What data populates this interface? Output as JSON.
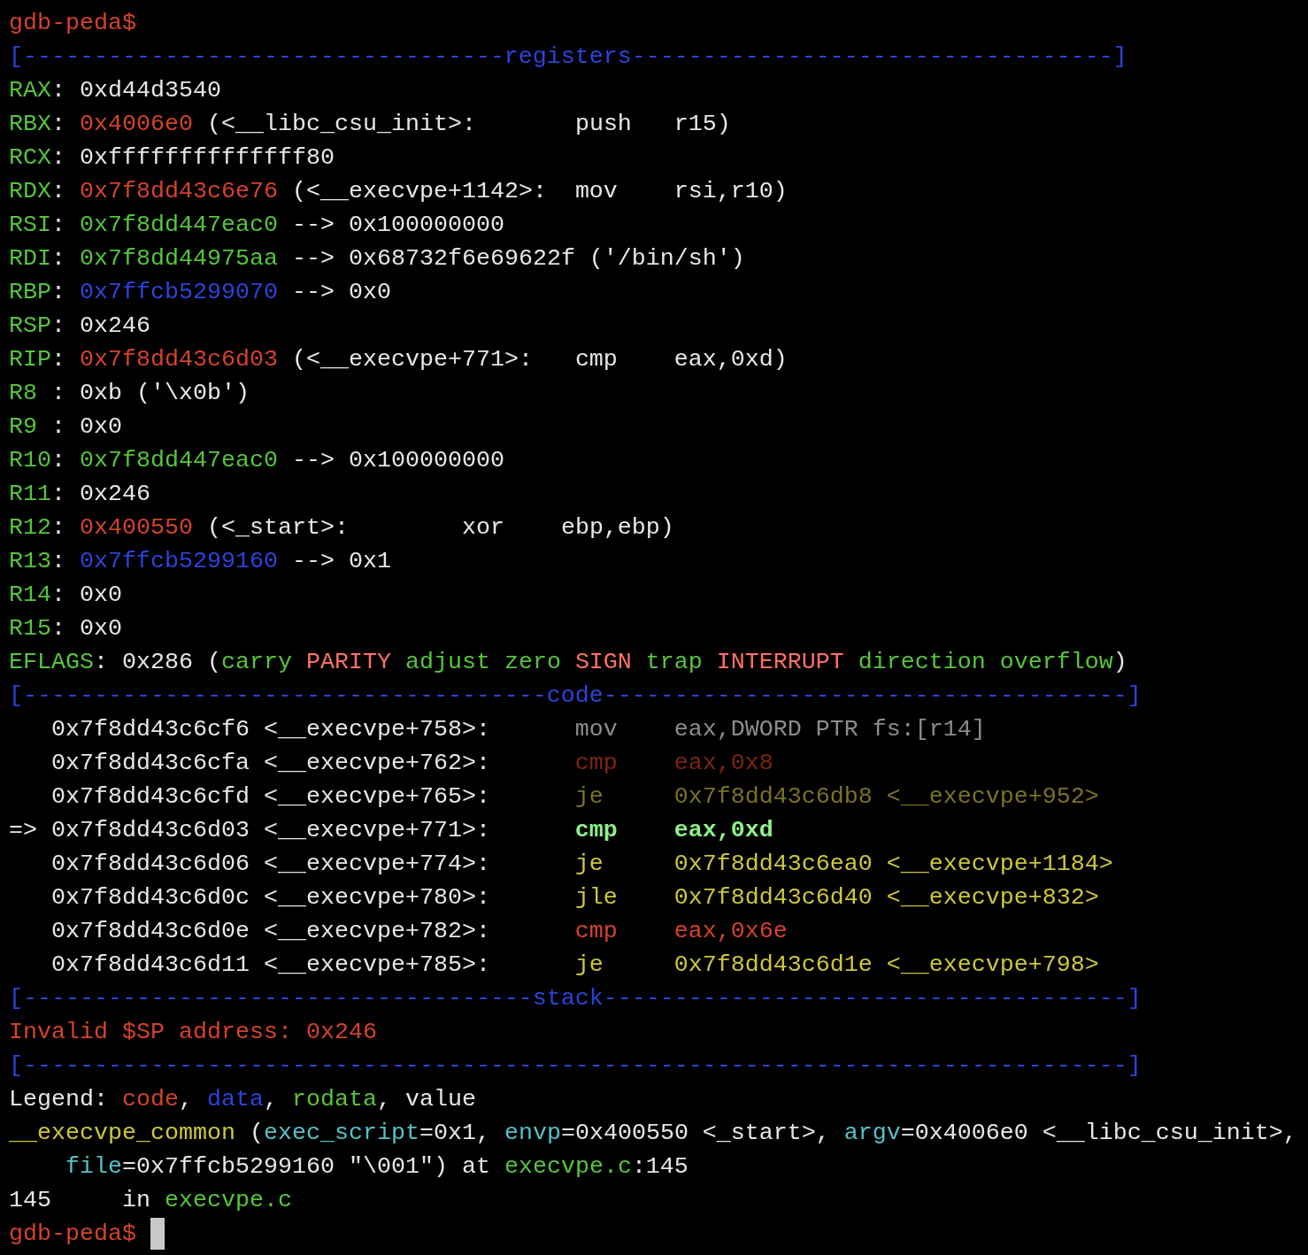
{
  "terminal": {
    "lines": [
      {
        "kind": "prompt",
        "cursor": false,
        "segments": [
          {
            "text": "gdb-peda$",
            "kind": "prompt"
          }
        ]
      },
      {
        "kind": "separator",
        "segments": [
          {
            "text": "[----------------------------------registers----------------------------------]",
            "kind": "separator"
          }
        ]
      },
      {
        "kind": "register",
        "segments": [
          {
            "text": "RAX",
            "kind": "register"
          },
          {
            "text": ": 0xd44d3540",
            "kind": "plain"
          }
        ]
      },
      {
        "kind": "register",
        "segments": [
          {
            "text": "RBX",
            "kind": "register"
          },
          {
            "text": ": ",
            "kind": "plain"
          },
          {
            "text": "0x4006e0",
            "kind": "code"
          },
          {
            "text": " (<__libc_csu_init>:       push   r15)",
            "kind": "plain"
          }
        ]
      },
      {
        "kind": "register",
        "segments": [
          {
            "text": "RCX",
            "kind": "register"
          },
          {
            "text": ": 0xffffffffffffff80",
            "kind": "plain"
          }
        ]
      },
      {
        "kind": "register",
        "segments": [
          {
            "text": "RDX",
            "kind": "register"
          },
          {
            "text": ": ",
            "kind": "plain"
          },
          {
            "text": "0x7f8dd43c6e76",
            "kind": "code"
          },
          {
            "text": " (<__execvpe+1142>:  mov    rsi,r10)",
            "kind": "plain"
          }
        ]
      },
      {
        "kind": "register",
        "segments": [
          {
            "text": "RSI",
            "kind": "register"
          },
          {
            "text": ": ",
            "kind": "plain"
          },
          {
            "text": "0x7f8dd447eac0",
            "kind": "rodata"
          },
          {
            "text": " --> 0x100000000",
            "kind": "plain"
          }
        ]
      },
      {
        "kind": "register",
        "segments": [
          {
            "text": "RDI",
            "kind": "register"
          },
          {
            "text": ": ",
            "kind": "plain"
          },
          {
            "text": "0x7f8dd44975aa",
            "kind": "rodata"
          },
          {
            "text": " --> 0x68732f6e69622f ('/bin/sh')",
            "kind": "plain"
          }
        ]
      },
      {
        "kind": "register",
        "segments": [
          {
            "text": "RBP",
            "kind": "register"
          },
          {
            "text": ": ",
            "kind": "plain"
          },
          {
            "text": "0x7ffcb5299070",
            "kind": "data"
          },
          {
            "text": " --> 0x0",
            "kind": "plain"
          }
        ]
      },
      {
        "kind": "register",
        "segments": [
          {
            "text": "RSP",
            "kind": "register"
          },
          {
            "text": ": 0x246",
            "kind": "plain"
          }
        ]
      },
      {
        "kind": "register",
        "segments": [
          {
            "text": "RIP",
            "kind": "register"
          },
          {
            "text": ": ",
            "kind": "plain"
          },
          {
            "text": "0x7f8dd43c6d03",
            "kind": "code"
          },
          {
            "text": " (<__execvpe+771>:   cmp    eax,0xd)",
            "kind": "plain"
          }
        ]
      },
      {
        "kind": "register",
        "segments": [
          {
            "text": "R8",
            "kind": "register"
          },
          {
            "text": " : 0xb ('\\x0b')",
            "kind": "plain"
          }
        ]
      },
      {
        "kind": "register",
        "segments": [
          {
            "text": "R9",
            "kind": "register"
          },
          {
            "text": " : 0x0",
            "kind": "plain"
          }
        ]
      },
      {
        "kind": "register",
        "segments": [
          {
            "text": "R10",
            "kind": "register"
          },
          {
            "text": ": ",
            "kind": "plain"
          },
          {
            "text": "0x7f8dd447eac0",
            "kind": "rodata"
          },
          {
            "text": " --> 0x100000000",
            "kind": "plain"
          }
        ]
      },
      {
        "kind": "register",
        "segments": [
          {
            "text": "R11",
            "kind": "register"
          },
          {
            "text": ": 0x246",
            "kind": "plain"
          }
        ]
      },
      {
        "kind": "register",
        "segments": [
          {
            "text": "R12",
            "kind": "register"
          },
          {
            "text": ": ",
            "kind": "plain"
          },
          {
            "text": "0x400550",
            "kind": "code"
          },
          {
            "text": " (<_start>:        xor    ebp,ebp)",
            "kind": "plain"
          }
        ]
      },
      {
        "kind": "register",
        "segments": [
          {
            "text": "R13",
            "kind": "register"
          },
          {
            "text": ": ",
            "kind": "plain"
          },
          {
            "text": "0x7ffcb5299160",
            "kind": "data"
          },
          {
            "text": " --> 0x1",
            "kind": "plain"
          }
        ]
      },
      {
        "kind": "register",
        "segments": [
          {
            "text": "R14",
            "kind": "register"
          },
          {
            "text": ": 0x0",
            "kind": "plain"
          }
        ]
      },
      {
        "kind": "register",
        "segments": [
          {
            "text": "R15",
            "kind": "register"
          },
          {
            "text": ": 0x0",
            "kind": "plain"
          }
        ]
      },
      {
        "kind": "register",
        "segments": [
          {
            "text": "EFLAGS",
            "kind": "register"
          },
          {
            "text": ": 0x286 (",
            "kind": "plain"
          },
          {
            "text": "carry ",
            "kind": "flag_clear"
          },
          {
            "text": "PARITY",
            "kind": "flag_set"
          },
          {
            "text": " adjust zero ",
            "kind": "flag_clear"
          },
          {
            "text": "SIGN",
            "kind": "flag_set"
          },
          {
            "text": " trap ",
            "kind": "flag_clear"
          },
          {
            "text": "INTERRUPT",
            "kind": "flag_set"
          },
          {
            "text": " direction overflow",
            "kind": "flag_clear"
          },
          {
            "text": ")",
            "kind": "plain"
          }
        ]
      },
      {
        "kind": "separator",
        "segments": [
          {
            "text": "[-------------------------------------code-------------------------------------]",
            "kind": "separator"
          }
        ]
      },
      {
        "kind": "code",
        "segments": [
          {
            "text": "   0x7f8dd43c6cf6 <__execvpe+758>:      ",
            "kind": "plain"
          },
          {
            "text": "mov    eax,DWORD PTR fs:[r14]",
            "kind": "dim_plain"
          }
        ]
      },
      {
        "kind": "code",
        "segments": [
          {
            "text": "   0x7f8dd43c6cfa <__execvpe+762>:      ",
            "kind": "plain"
          },
          {
            "text": "cmp    eax,0x8",
            "kind": "dim_code"
          }
        ]
      },
      {
        "kind": "code",
        "segments": [
          {
            "text": "   0x7f8dd43c6cfd <__execvpe+765>:      ",
            "kind": "plain"
          },
          {
            "text": "je     0x7f8dd43c6db8 <__execvpe+952>",
            "kind": "dim_jump"
          }
        ]
      },
      {
        "kind": "code",
        "segments": [
          {
            "text": "=> 0x7f8dd43c6d03 <__execvpe+771>:      ",
            "kind": "plain"
          },
          {
            "text": "cmp    eax,0xd",
            "kind": "current"
          }
        ]
      },
      {
        "kind": "code",
        "segments": [
          {
            "text": "   0x7f8dd43c6d06 <__execvpe+774>:      ",
            "kind": "plain"
          },
          {
            "text": "je     0x7f8dd43c6ea0 <__execvpe+1184>",
            "kind": "jump"
          }
        ]
      },
      {
        "kind": "code",
        "segments": [
          {
            "text": "   0x7f8dd43c6d0c <__execvpe+780>:      ",
            "kind": "plain"
          },
          {
            "text": "jle    0x7f8dd43c6d40 <__execvpe+832>",
            "kind": "jump"
          }
        ]
      },
      {
        "kind": "code",
        "segments": [
          {
            "text": "   0x7f8dd43c6d0e <__execvpe+782>:      ",
            "kind": "plain"
          },
          {
            "text": "cmp    eax,0x6e",
            "kind": "code"
          }
        ]
      },
      {
        "kind": "code",
        "segments": [
          {
            "text": "   0x7f8dd43c6d11 <__execvpe+785>:      ",
            "kind": "plain"
          },
          {
            "text": "je     0x7f8dd43c6d1e <__execvpe+798>",
            "kind": "jump"
          }
        ]
      },
      {
        "kind": "separator",
        "segments": [
          {
            "text": "[------------------------------------stack-------------------------------------]",
            "kind": "separator"
          }
        ]
      },
      {
        "kind": "error",
        "segments": [
          {
            "text": "Invalid $SP address: 0x246",
            "kind": "error"
          }
        ]
      },
      {
        "kind": "separator",
        "segments": [
          {
            "text": "[------------------------------------------------------------------------------]",
            "kind": "separator"
          }
        ]
      },
      {
        "kind": "text",
        "segments": [
          {
            "text": "Legend: ",
            "kind": "plain"
          },
          {
            "text": "code",
            "kind": "code"
          },
          {
            "text": ", ",
            "kind": "plain"
          },
          {
            "text": "data",
            "kind": "data"
          },
          {
            "text": ", ",
            "kind": "plain"
          },
          {
            "text": "rodata",
            "kind": "rodata"
          },
          {
            "text": ", value",
            "kind": "plain"
          }
        ]
      },
      {
        "kind": "text",
        "segments": [
          {
            "text": "__execvpe_common",
            "kind": "function"
          },
          {
            "text": " (",
            "kind": "plain"
          },
          {
            "text": "exec_script",
            "kind": "argument"
          },
          {
            "text": "=0x1, ",
            "kind": "plain"
          },
          {
            "text": "envp",
            "kind": "argument"
          },
          {
            "text": "=0x400550 <_start>, ",
            "kind": "plain"
          },
          {
            "text": "argv",
            "kind": "argument"
          },
          {
            "text": "=0x4006e0 <__libc_csu_init>,",
            "kind": "plain"
          }
        ]
      },
      {
        "kind": "continuation",
        "segments": [
          {
            "text": "file",
            "kind": "argument"
          },
          {
            "text": "=0x7ffcb5299160 \"\\001\") at ",
            "kind": "plain"
          },
          {
            "text": "execvpe.c",
            "kind": "rodata"
          },
          {
            "text": ":145",
            "kind": "plain"
          }
        ]
      },
      {
        "kind": "text",
        "segments": [
          {
            "text": "145     in ",
            "kind": "plain"
          },
          {
            "text": "execvpe.c",
            "kind": "rodata"
          }
        ]
      },
      {
        "kind": "prompt",
        "cursor": true,
        "segments": [
          {
            "text": "gdb-peda$",
            "kind": "prompt"
          }
        ]
      }
    ]
  }
}
